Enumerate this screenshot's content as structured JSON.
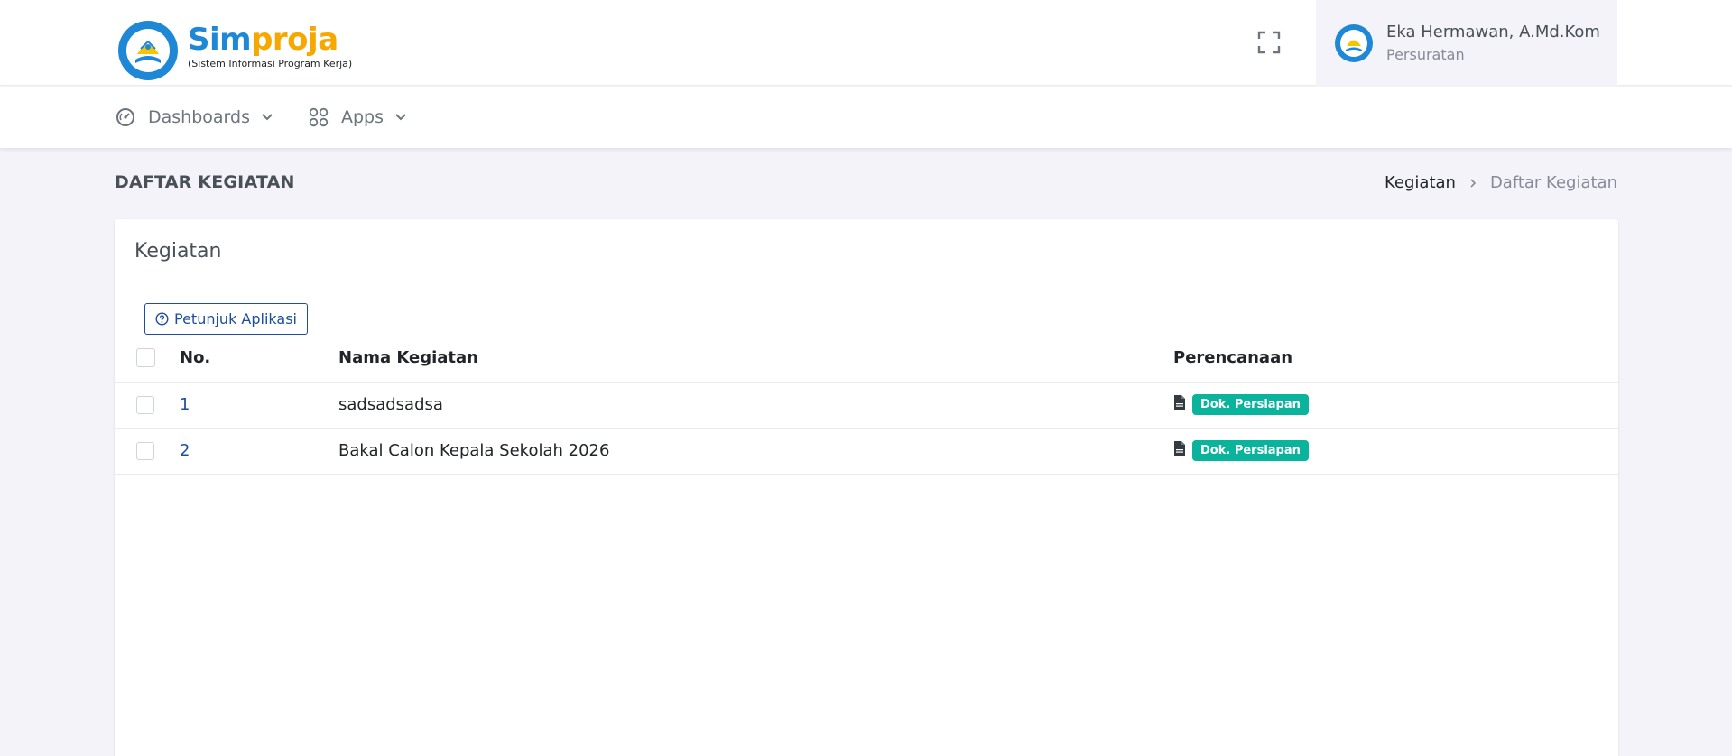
{
  "app": {
    "logo_sim": "Sim",
    "logo_proja": "proja",
    "logo_subtitle": "(Sistem Informasi Program Kerja)"
  },
  "user": {
    "name": "Eka Hermawan, A.Md.Kom",
    "role": "Persuratan"
  },
  "nav": {
    "items": [
      {
        "label": "Dashboards",
        "icon": "speedometer-icon"
      },
      {
        "label": "Apps",
        "icon": "grid-icon"
      }
    ]
  },
  "page": {
    "title": "DAFTAR KEGIATAN",
    "breadcrumb": [
      "Kegiatan",
      "Daftar Kegiatan"
    ]
  },
  "card": {
    "title": "Kegiatan",
    "help_button": "Petunjuk Aplikasi"
  },
  "table": {
    "columns": [
      "No.",
      "Nama Kegiatan",
      "Perencanaan"
    ],
    "rows": [
      {
        "no": "1",
        "name": "sadsadsadsa",
        "badge": "Dok. Persiapan"
      },
      {
        "no": "2",
        "name": "Bakal Calon Kepala Sekolah 2026",
        "badge": "Dok. Persiapan"
      }
    ]
  },
  "colors": {
    "primary": "#1d4e9e",
    "logo_blue": "#1e88d6",
    "logo_orange": "#f7a800",
    "badge_green": "#0ab39c",
    "page_bg": "#f3f3f9"
  }
}
